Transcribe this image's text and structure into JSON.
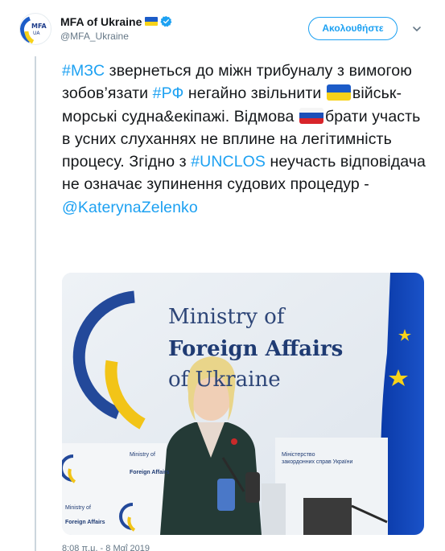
{
  "tweet": {
    "display_name": "MFA of Ukraine",
    "handle": "@MFA_Ukraine",
    "follow_label": "Ακολουθήστε",
    "text": {
      "hashtag_mzs": "#МЗС",
      "part1": " звернеться до міжн трибуналу з вимогою зобов’язати ",
      "hashtag_rf": "#РФ",
      "part2": " негайно звільнити ",
      "part3": "військ-морські судна&екіпажі. Відмова ",
      "part4": "брати участь в усних слуханнях не вплине на легітимність процесу. Згідно з ",
      "hashtag_unclos": "#UNCLOS",
      "part5": " неучасть відповідача не означає зупинення судових процедур - ",
      "mention": "@KaterynaZelenko"
    },
    "timestamp": "8:08 π.μ. - 8 Μαΐ 2019"
  },
  "avatar": {
    "logo_text": "MFA",
    "logo_sub": "UA"
  },
  "media": {
    "wall_line1": "Ministry of",
    "wall_line2": "Foreign Affairs",
    "wall_line3": "of Ukraine",
    "podium_left_line1": "Ministry of",
    "podium_left_line2": "Foreign Affairs",
    "podium_right_line1": "Міністерство",
    "podium_right_line2": "закордонних справ України",
    "podium_bottom_line1": "Ministry of",
    "podium_bottom_line2": "Foreign Affairs"
  },
  "colors": {
    "link": "#1da1f2",
    "text": "#14171a",
    "muted": "#657786",
    "ua_blue": "#1c5cc8",
    "ua_yellow": "#f7d219"
  },
  "icons": {
    "verified": "verified-badge-icon",
    "chevron": "chevron-down-icon",
    "flag_ua": "ukraine-flag-icon",
    "flag_ru": "russia-flag-icon"
  }
}
